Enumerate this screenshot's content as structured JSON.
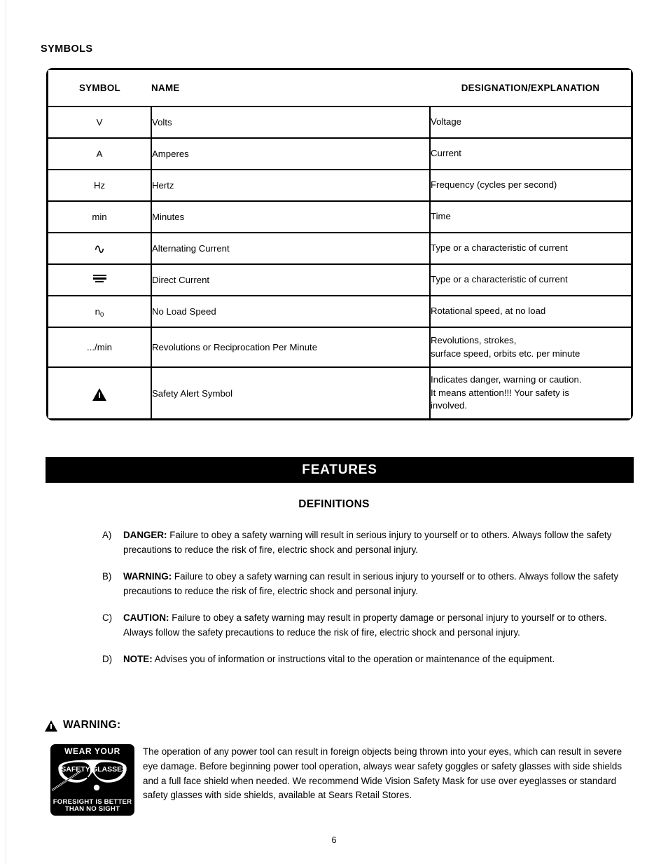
{
  "document": {
    "section_heading": "SYMBOLS",
    "page_number": "6"
  },
  "symbols_table": {
    "headers": {
      "symbol": "SYMBOL",
      "name": "NAME",
      "designation": "DESIGNATION/EXPLANATION"
    },
    "rows": [
      {
        "symbol": "V",
        "symbol_kind": "text",
        "name": "Volts",
        "designation": "Voltage"
      },
      {
        "symbol": "A",
        "symbol_kind": "text",
        "name": "Amperes",
        "designation": "Current"
      },
      {
        "symbol": "Hz",
        "symbol_kind": "text",
        "name": "Hertz",
        "designation": "Frequency (cycles per second)"
      },
      {
        "symbol": "min",
        "symbol_kind": "text",
        "name": "Minutes",
        "designation": "Time"
      },
      {
        "symbol": "∿",
        "symbol_kind": "ac-wave",
        "name": "Alternating Current",
        "designation": "Type or a characteristic of current"
      },
      {
        "symbol": "⎓",
        "symbol_kind": "dc-lines",
        "name": "Direct Current",
        "designation": "Type or a characteristic of current"
      },
      {
        "symbol": "n0",
        "symbol_kind": "subscript",
        "name": "No Load Speed",
        "designation": "Rotational speed, at no load"
      },
      {
        "symbol": ".../min",
        "symbol_kind": "text",
        "name": "Revolutions or Reciprocation Per Minute",
        "designation": "Revolutions, strokes,\nsurface speed, orbits etc. per minute"
      },
      {
        "symbol": "⚠",
        "symbol_kind": "alert-triangle",
        "name": "Safety Alert Symbol",
        "designation": "Indicates danger, warning or caution.\nIt means attention!!! Your safety is\ninvolved."
      }
    ]
  },
  "features": {
    "banner_title": "FEATURES",
    "definitions_title": "DEFINITIONS",
    "definitions": [
      {
        "marker": "A)",
        "term": "DANGER:",
        "text": " Failure to obey a safety warning will result in serious injury to yourself or to others. Always follow the safety precautions to reduce the risk of fire, electric shock and personal injury."
      },
      {
        "marker": "B)",
        "term": "WARNING:",
        "text": " Failure to obey a safety warning can result in serious injury to yourself or to others. Always follow the safety precautions to reduce the risk of fire, electric shock and personal injury."
      },
      {
        "marker": "C)",
        "term": "CAUTION:",
        "text": " Failure to obey a safety warning may result in property damage or personal injury to yourself or to others. Always follow the safety precautions to reduce the risk of fire, electric shock and personal injury."
      },
      {
        "marker": "D)",
        "term": "NOTE:",
        "text": "  Advises you of information or instructions vital to the operation or maintenance of the equipment."
      }
    ]
  },
  "warning_block": {
    "heading": "WARNING:",
    "sign": {
      "line_top": "WEAR YOUR",
      "lens_left": "SAFETY",
      "lens_right": "GLASSES",
      "line_bottom_1": "FORESIGHT IS BETTER",
      "line_bottom_2": "THAN NO SIGHT"
    },
    "body": "The operation of any power tool can result in foreign objects being thrown into your eyes, which can result in severe eye damage. Before beginning power tool operation, always wear safety goggles or safety glasses with side shields and a full face shield when needed. We recommend Wide Vision Safety Mask for use over eyeglasses or standard safety glasses with side shields, available at Sears Retail Stores."
  }
}
